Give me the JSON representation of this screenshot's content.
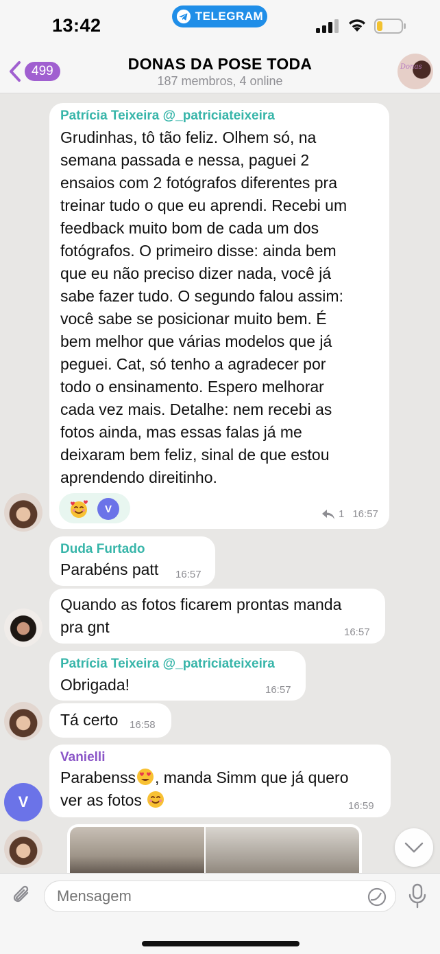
{
  "status_bar": {
    "time": "13:42",
    "app_pill": "TELEGRAM"
  },
  "header": {
    "back_count": "499",
    "title": "DONAS DA POSE TODA",
    "subtitle": "187 membros, 4 online"
  },
  "messages": [
    {
      "sender": "Patrícia Teixeira @_patriciateixeira",
      "sender_color": "#37b5a9",
      "lines": [
        "Grudinhas, tô tão feliz. Olhem só, na",
        "semana passada e nessa, paguei 2",
        "ensaios com 2 fotógrafos diferentes pra",
        "treinar tudo o que eu aprendi. Recebi um",
        "feedback muito bom de cada um dos",
        "fotógrafos. O primeiro disse: ainda bem",
        "que eu não preciso dizer nada, você já",
        "sabe fazer tudo. O segundo falou assim:",
        "você sabe se posicionar muito bem. É",
        "bem melhor que várias modelos que já",
        "peguei. Cat, só tenho a agradecer por",
        "todo o ensinamento. Espero melhorar",
        "cada vez mais. Detalhe: nem recebi as",
        "fotos ainda, mas essas falas já me",
        "deixaram bem feliz, sinal de que estou",
        "aprendendo direitinho."
      ],
      "reaction_emoji": "smiling-face-with-hearts",
      "reaction_user": "V",
      "replies": "1",
      "time": "16:57"
    },
    {
      "sender": "Duda Furtado",
      "sender_color": "#37b5a9",
      "text": "Parabéns patt",
      "time": "16:57"
    },
    {
      "lines": [
        "Quando as fotos ficarem prontas manda",
        "pra gnt"
      ],
      "time": "16:57"
    },
    {
      "sender": "Patrícia Teixeira @_patriciateixeira",
      "sender_color": "#37b5a9",
      "text": "Obrigada!",
      "time": "16:57"
    },
    {
      "text": "Tá certo",
      "time": "16:58"
    },
    {
      "sender": "Vanielli",
      "sender_color": "#8a55c7",
      "line1_a": "Parabenss",
      "line1_b": ", manda Simm que já quero",
      "line2": "ver as fotos ",
      "avatar_letter": "V",
      "time": "16:59"
    }
  ],
  "input": {
    "placeholder": "Mensagem"
  },
  "icons": [
    "back-chevron-icon",
    "telegram-icon",
    "signal-icon",
    "wifi-icon",
    "battery-icon",
    "reply-arrow-icon",
    "chevron-down-icon",
    "paperclip-icon",
    "sticker-icon",
    "microphone-icon"
  ],
  "colors": {
    "accent": "#a05fd0",
    "teal_name": "#37b5a9",
    "purple_name": "#8a55c7",
    "avatar_v": "#6b73e8",
    "telegram_blue": "#1f8ee8"
  }
}
